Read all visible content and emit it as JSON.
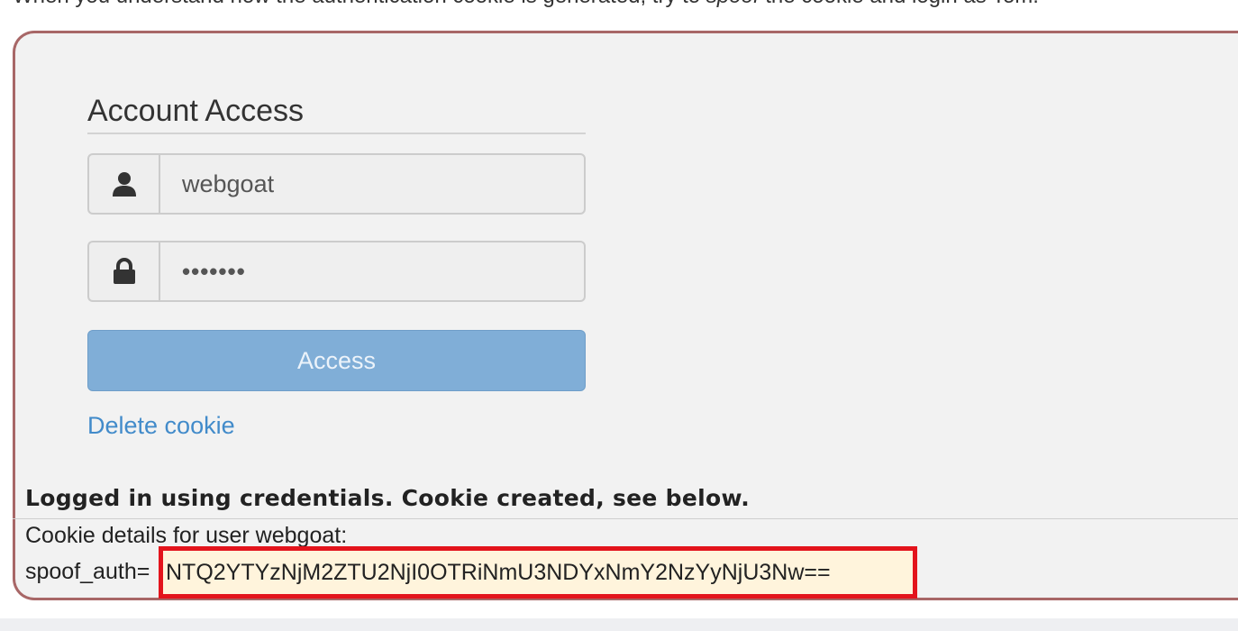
{
  "intro": {
    "text_before": "When you understand how the authentication cookie is generated, try to ",
    "text_em": "spoof",
    "text_after": " the cookie and login as Tom."
  },
  "form": {
    "legend": "Account Access",
    "username_value": "webgoat",
    "password_value": "•••••••",
    "access_button_label": "Access",
    "delete_cookie_link": "Delete cookie"
  },
  "icons": {
    "username_addon": "user-icon",
    "password_addon": "lock-icon"
  },
  "feedback": {
    "message": "Logged in using credentials. Cookie created, see below."
  },
  "output": {
    "cookie_details": "Cookie details for user webgoat:",
    "cookie_name": "spoof_auth=",
    "cookie_value": "NTQ2YTYzNjM2ZTU2NjI0OTRiNmU3NDYxNmY2NzYyNjU3Nw=="
  },
  "colors": {
    "accent_border": "#a86767",
    "button_bg": "#80aed7",
    "link": "#428bca",
    "highlight_border": "#e3141c",
    "highlight_bg": "#fff4dc"
  }
}
